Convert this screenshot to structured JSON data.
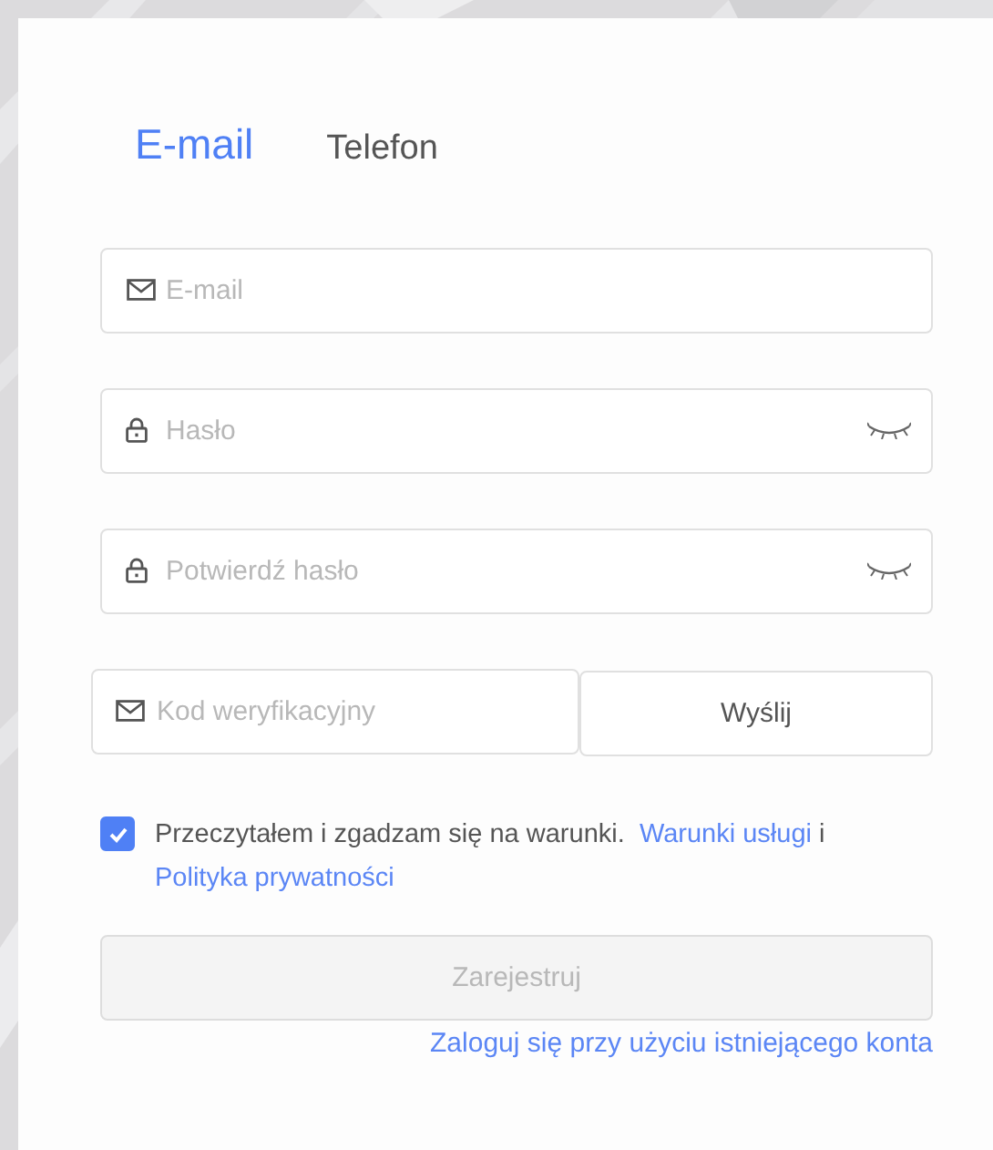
{
  "tabs": [
    {
      "label": "E-mail",
      "selected": true
    },
    {
      "label": "Telefon",
      "selected": false
    }
  ],
  "fields": [
    {
      "kind": "email",
      "placeholder": "E-mail",
      "reveal": false
    },
    {
      "kind": "password",
      "placeholder": "Hasło",
      "reveal": true
    },
    {
      "kind": "password",
      "placeholder": "Potwierdź hasło",
      "reveal": true
    }
  ],
  "code": {
    "placeholder": "Kod weryfikacyjny",
    "button": "Wyślij"
  },
  "agreement": {
    "checked": true,
    "text": "Przeczytałem i zgadzam się na warunki.",
    "links": [
      "Warunki usługi",
      "Polityka prywatności"
    ],
    "joiner": "i"
  },
  "register": {
    "label": "Zarejestruj",
    "disabled": true
  },
  "login_link": "Zaloguj się przy użyciu istniejącego konta"
}
